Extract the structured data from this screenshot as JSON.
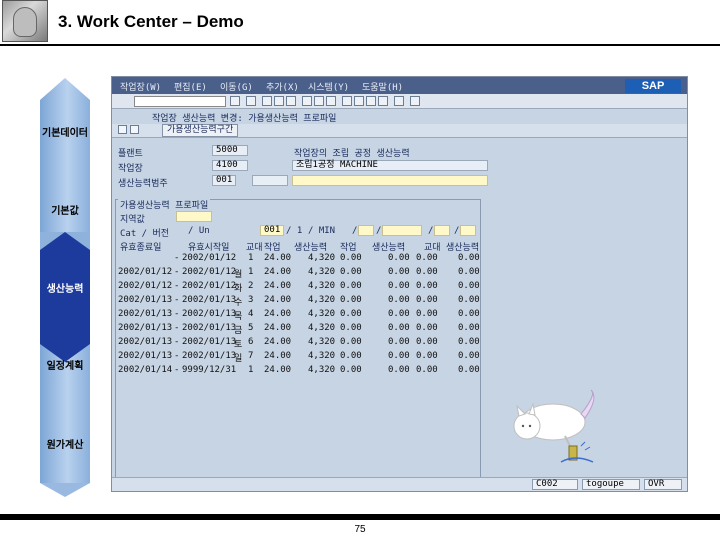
{
  "slide": {
    "title": "3. Work Center – Demo",
    "page_number": "75"
  },
  "nav": {
    "items": [
      {
        "label": "기본데이터",
        "active": false
      },
      {
        "label": "기본값",
        "active": false
      },
      {
        "label": "생산능력",
        "active": true
      },
      {
        "label": "일정계획",
        "active": false
      },
      {
        "label": "원가계산",
        "active": false
      }
    ]
  },
  "sap": {
    "menu": [
      "작업장(W)",
      "편집(E)",
      "이동(G)",
      "추가(X)",
      "시스템(Y)",
      "도움말(H)"
    ],
    "brand": "SAP",
    "screen_title": "작업장 생산능력 변경: 가용생산능력 프로파일",
    "sub_tab": "가용생산능력구간",
    "header": {
      "plant_label": "플랜트",
      "plant_value": "5000",
      "workcenter_label": "작업장",
      "workcenter_value": "4100",
      "capcat_label": "생산능력범주",
      "capcat_value": "001",
      "desc_label": "작업장의 조립 공정 생산능력",
      "desc_value": "조립1공정 MACHINE"
    },
    "profile_group": {
      "title": "가용생산능력 프로파일",
      "active_version_label": "지역값",
      "subheader": [
        "Cat / 버전",
        "/ Un",
        "001",
        "/ 1",
        "/ MIN",
        "/",
        "/",
        "/",
        "/"
      ]
    },
    "columns": [
      "유효종료일",
      "유효시작일",
      "교대",
      "작업",
      "생산능력",
      "작업",
      "생산능력",
      "교대",
      "생산능력"
    ],
    "rows": [
      {
        "from": "",
        "to": "2002/01/12",
        "day": "",
        "shift": "1",
        "hours": "24.00",
        "cap": "4,320",
        "c1": "0.00",
        "c2": "0.00",
        "c3": "0.00",
        "c4": "0.00"
      },
      {
        "from": "2002/01/12",
        "to": "2002/01/12",
        "day": "월",
        "shift": "1",
        "hours": "24.00",
        "cap": "4,320",
        "c1": "0.00",
        "c2": "0.00",
        "c3": "0.00",
        "c4": "0.00"
      },
      {
        "from": "2002/01/12",
        "to": "2002/01/12",
        "day": "화",
        "shift": "2",
        "hours": "24.00",
        "cap": "4,320",
        "c1": "0.00",
        "c2": "0.00",
        "c3": "0.00",
        "c4": "0.00"
      },
      {
        "from": "2002/01/13",
        "to": "2002/01/13",
        "day": "수",
        "shift": "3",
        "hours": "24.00",
        "cap": "4,320",
        "c1": "0.00",
        "c2": "0.00",
        "c3": "0.00",
        "c4": "0.00"
      },
      {
        "from": "2002/01/13",
        "to": "2002/01/13",
        "day": "목",
        "shift": "4",
        "hours": "24.00",
        "cap": "4,320",
        "c1": "0.00",
        "c2": "0.00",
        "c3": "0.00",
        "c4": "0.00"
      },
      {
        "from": "2002/01/13",
        "to": "2002/01/13",
        "day": "금",
        "shift": "5",
        "hours": "24.00",
        "cap": "4,320",
        "c1": "0.00",
        "c2": "0.00",
        "c3": "0.00",
        "c4": "0.00"
      },
      {
        "from": "2002/01/13",
        "to": "2002/01/13",
        "day": "토",
        "shift": "6",
        "hours": "24.00",
        "cap": "4,320",
        "c1": "0.00",
        "c2": "0.00",
        "c3": "0.00",
        "c4": "0.00"
      },
      {
        "from": "2002/01/13",
        "to": "2002/01/13",
        "day": "일",
        "shift": "7",
        "hours": "24.00",
        "cap": "4,320",
        "c1": "0.00",
        "c2": "0.00",
        "c3": "0.00",
        "c4": "0.00"
      },
      {
        "from": "2002/01/14",
        "to": "9999/12/31",
        "day": "",
        "shift": "1",
        "hours": "24.00",
        "cap": "4,320",
        "c1": "0.00",
        "c2": "0.00",
        "c3": "0.00",
        "c4": "0.00"
      }
    ],
    "status": {
      "system": "C002",
      "server": "togoupe",
      "mode": "OVR"
    }
  }
}
